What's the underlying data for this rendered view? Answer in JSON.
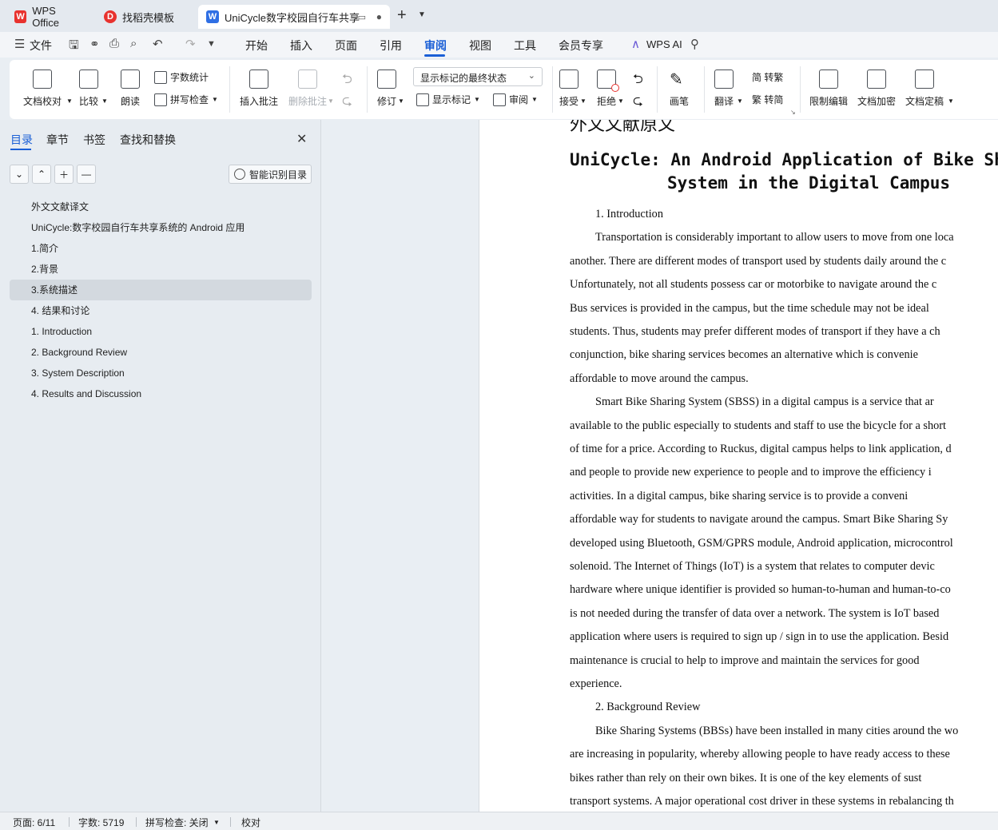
{
  "tabs": [
    {
      "label": "WPS Office",
      "icon": "wps-logo-icon"
    },
    {
      "label": "找稻壳模板",
      "icon": "docer-icon"
    },
    {
      "label": "UniCycle数字校园自行车共享",
      "icon": "writer-doc-icon"
    }
  ],
  "menubar": {
    "file": "文件",
    "items": [
      "开始",
      "插入",
      "页面",
      "引用",
      "审阅",
      "视图",
      "工具",
      "会员专享"
    ],
    "active": "审阅",
    "ai": "WPS AI"
  },
  "ribbon": {
    "proofread": "文档校对",
    "compare": "比较",
    "read_aloud": "朗读",
    "word_count": "字数统计",
    "spell_check": "拼写检查",
    "insert_comment": "插入批注",
    "delete_comment": "删除批注",
    "track_changes": "修订",
    "markup_select": "显示标记的最终状态",
    "show_markup": "显示标记",
    "review": "审阅",
    "accept": "接受",
    "reject": "拒绝",
    "pen": "画笔",
    "translate": "翻译",
    "to_traditional": "简 转繁",
    "to_simplified": "繁 转简",
    "restrict_edit": "限制编辑",
    "encrypt": "文档加密",
    "finalize": "文档定稿"
  },
  "sidebar": {
    "tabs": [
      "目录",
      "章节",
      "书签",
      "查找和替换"
    ],
    "smart_toc": "智能识别目录",
    "toc": [
      "外文文献译文",
      "UniCycle:数字校园自行车共享系统的 Android 应用",
      "1.简介",
      "2.背景",
      "3.系统描述",
      "4. 结果和讨论",
      "1. Introduction",
      "2. Background Review",
      "3. System Description",
      "4. Results and Discussion"
    ],
    "selected_index": 4
  },
  "document": {
    "cut_heading": "外文文献原文",
    "title_line1": "UniCycle: An Android Application of Bike Sha",
    "title_line2": "System in the Digital Campus",
    "lines": [
      {
        "text": "1. Introduction",
        "indent": true
      },
      {
        "text": "Transportation is considerably important to allow users to move from one loca",
        "indent": true
      },
      {
        "text": "another. There are different modes of transport used by students daily around the c",
        "indent": false
      },
      {
        "text": "Unfortunately, not all students possess car or motorbike to navigate around the c",
        "indent": false
      },
      {
        "text": "Bus services is provided in the campus, but the time schedule may not be ideal",
        "indent": false
      },
      {
        "text": "students. Thus, students may prefer different modes of transport if they have a ch",
        "indent": false
      },
      {
        "text": "conjunction, bike sharing services becomes an alternative which is convenie",
        "indent": false
      },
      {
        "text": "affordable to move around the campus.",
        "indent": false
      },
      {
        "text": "Smart Bike Sharing System (SBSS) in a digital campus is a service that ar",
        "indent": true
      },
      {
        "text": "available to the public especially to students and staff to use the bicycle for a short",
        "indent": false
      },
      {
        "text": "of time for a price. According to Ruckus, digital campus helps to link application, d",
        "indent": false
      },
      {
        "text": "and people to provide new experience to people and to improve the efficiency i",
        "indent": false
      },
      {
        "text": "activities. In a digital campus, bike sharing service is to provide a conveni",
        "indent": false
      },
      {
        "text": "affordable way for students to navigate around the campus. Smart Bike Sharing Sy",
        "indent": false
      },
      {
        "text": "developed using Bluetooth, GSM/GPRS module, Android application, microcontrol",
        "indent": false
      },
      {
        "text": "solenoid. The Internet of Things (IoT) is a system that relates to computer devic",
        "indent": false
      },
      {
        "text": "hardware where unique identifier is provided so human-to-human and human-to-co",
        "indent": false
      },
      {
        "text": "is not needed during the transfer of data over a network. The system is IoT based",
        "indent": false
      },
      {
        "text": "application where users is required to sign up / sign in to use the application. Besid",
        "indent": false
      },
      {
        "text": "maintenance is crucial to help to improve and maintain the services for good",
        "indent": false
      },
      {
        "text": "experience.",
        "indent": false
      },
      {
        "text": "2. Background Review",
        "indent": true
      },
      {
        "text": "Bike Sharing Systems (BBSs) have been installed in many cities around the wo",
        "indent": true
      },
      {
        "text": "are increasing in popularity, whereby allowing people to have ready access to these",
        "indent": false
      },
      {
        "text": "bikes rather than rely on their own bikes. It is one of the key elements of sust",
        "indent": false
      },
      {
        "text": "transport systems. A major operational cost driver in these systems in rebalancing th",
        "indent": false
      }
    ]
  },
  "statusbar": {
    "page": "页面: 6/11",
    "words": "字数: 5719",
    "spell": "拼写检查: 关闭",
    "proof": "校对"
  },
  "colors": {
    "accent": "#1a5fd6",
    "wps_red": "#e8322e",
    "writer_blue": "#2f6fe4"
  }
}
